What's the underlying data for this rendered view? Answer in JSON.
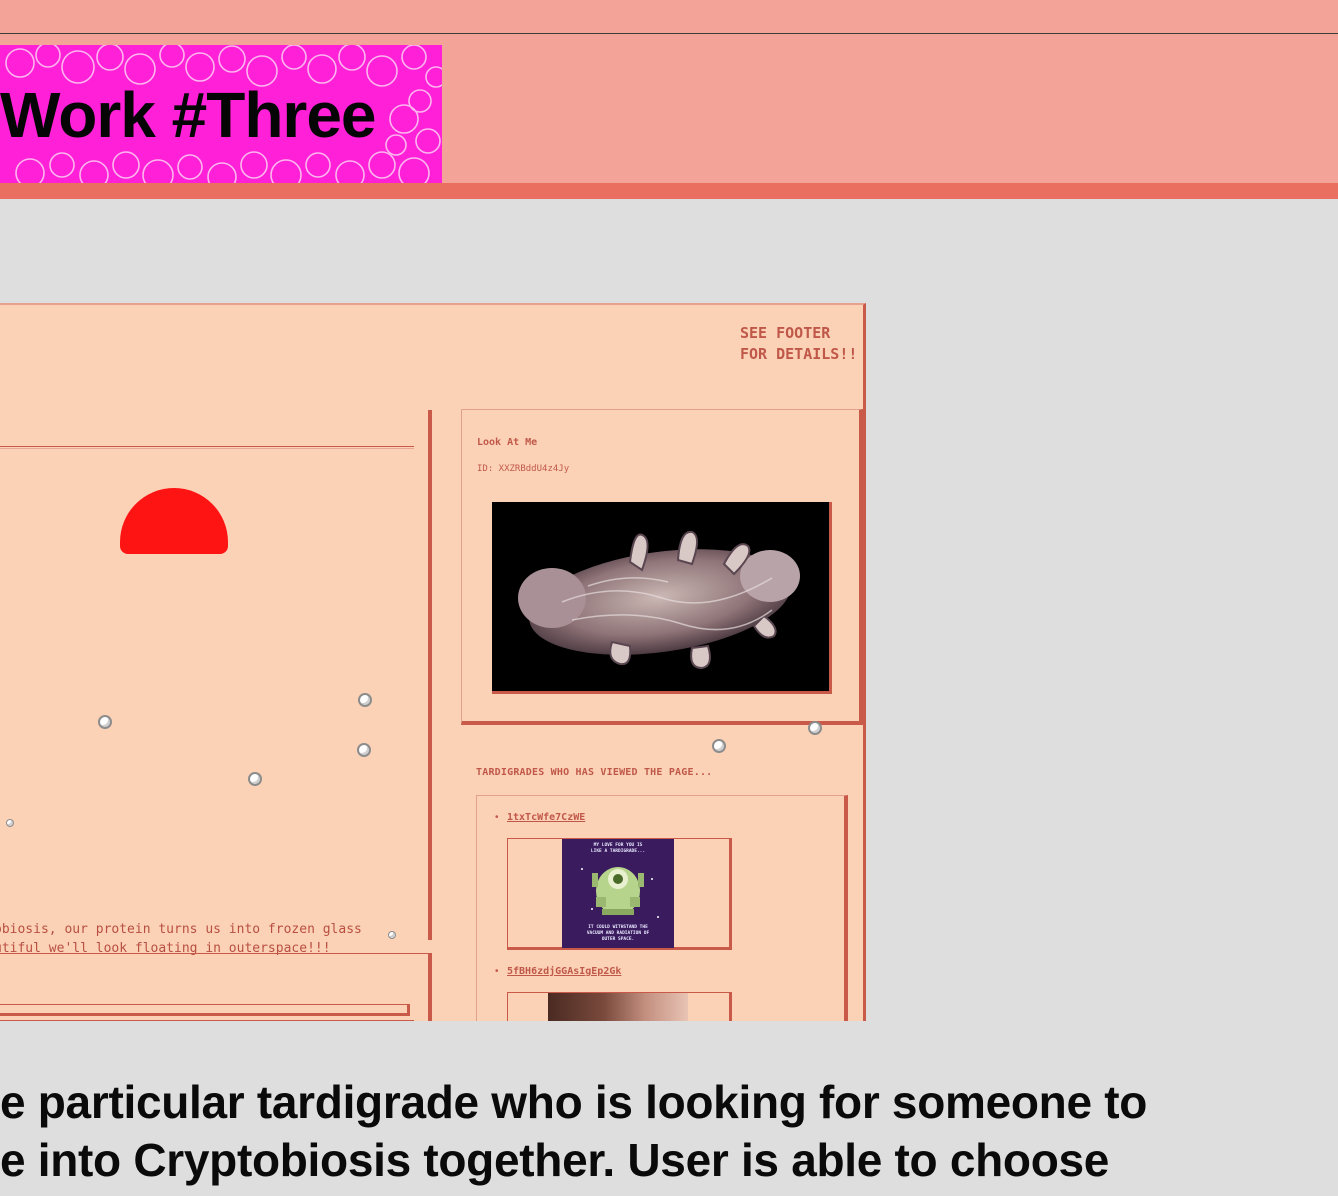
{
  "header": {
    "title": "Work #Three"
  },
  "embedded_page": {
    "notice": "SEE FOOTER\nFOR DETAILS!!",
    "caption": "obiosis, our protein turns us into frozen glass\nutiful we'll look floating in outerspace!!!",
    "look_card": {
      "title": "Look At Me",
      "id_label": "ID: XXZRBddU4z4Jy"
    },
    "viewers": {
      "heading": "TARDIGRADES WHO HAS VIEWED THE PAGE...",
      "items": [
        {
          "label": "1txTcWfe7CzWE",
          "gif_top_text": "MY LOVE FOR YOU IS\nLIKE A TARDIGRADE...",
          "gif_bottom_text": "IT COULD WITHSTAND THE\nVACUUM AND RADIATION OF\nOUTER SPACE."
        },
        {
          "label": "5fBH6zdjGGAsIgEp2Gk"
        }
      ]
    }
  },
  "description": {
    "line1": "e particular tardigrade who is looking for someone to",
    "line2": "e into Cryptobiosis together. User is able to choose"
  },
  "colors": {
    "header_bg": "#f3a398",
    "header_accent": "#ea6f60",
    "title_bg": "#ff20d8",
    "page_bg": "#dedede",
    "embedded_bg": "#fcd2b6",
    "embedded_ink": "#c0584a",
    "sun": "#ff1414"
  }
}
